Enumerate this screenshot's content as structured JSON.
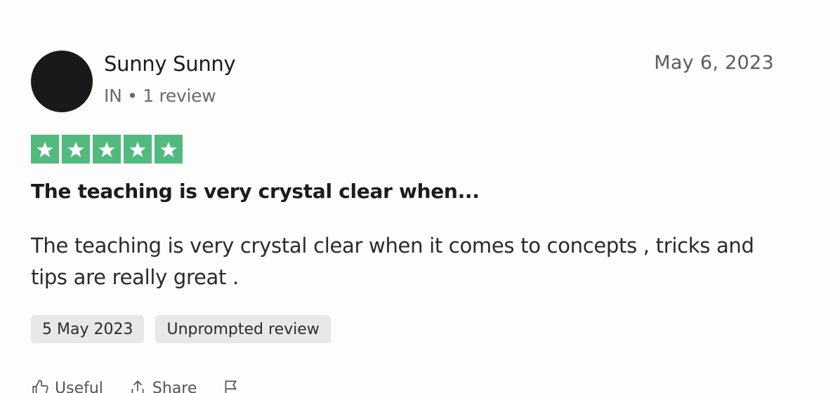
{
  "review": {
    "reviewer_name": "Sunny Sunny",
    "reviewer_meta": "IN • 1 review",
    "review_date": "May 6, 2023",
    "rating": 5,
    "rating_max": 5,
    "title": "The teaching is very crystal clear when...",
    "body": "The teaching is very crystal clear when it comes to concepts , tricks and tips are really great .",
    "tags": {
      "experience_date": "5 May 2023",
      "prompt_status": "Unprompted review"
    },
    "actions": {
      "useful_label": "Useful",
      "share_label": "Share",
      "report_icon": "flag-icon"
    }
  },
  "colors": {
    "star_green": "#52b97f",
    "avatar": "#191919",
    "tag_bg": "#e8e8e6"
  }
}
